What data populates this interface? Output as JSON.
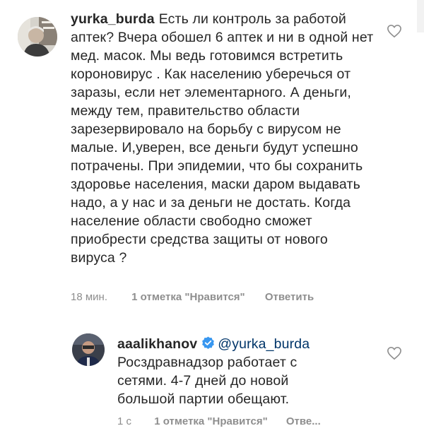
{
  "comment": {
    "username": "yurka_burda",
    "text": "Есть ли контроль за работой аптек?  Вчера обошел 6 аптек и ни в одной нет мед. масок. Мы ведь готовимся встретить короновирус . Как населению уберечься от заразы, если нет элементарного. А деньги, между тем, правительство области зарезервировало на борьбу с вирусом не малые. И,уверен, все деньги будут успешно  потрачены. При эпидемии, что бы сохранить здоровье населения, маски даром выдавать надо, а у нас и за деньги не достать. Когда население области свободно сможет приобрести средства защиты от нового вируса ?",
    "time": "18 мин.",
    "likes": "1 отметка \"Нравится\"",
    "reply_label": "Ответить"
  },
  "reply": {
    "username": "aaalikhanov",
    "mention": "@yurka_burda",
    "text": "Росздравнадзор работает с сетями. 4-7 дней до новой большой партии обещают.",
    "time": "1 с",
    "likes": "1 отметка \"Нравится\"",
    "reply_label": "Отве..."
  },
  "icons": {
    "like": "heart-icon",
    "verified": "verified-badge-icon",
    "more": "more-icon"
  },
  "colors": {
    "text": "#262626",
    "secondary": "#8e8e8e",
    "verified": "#3897f0"
  }
}
